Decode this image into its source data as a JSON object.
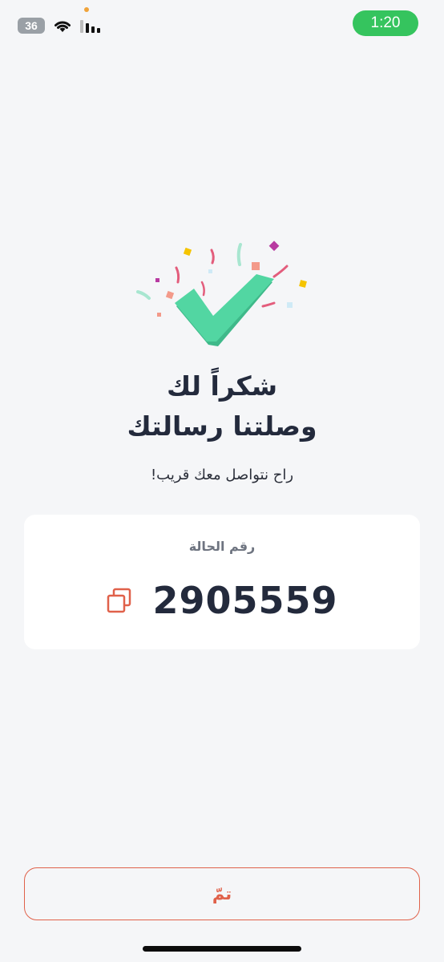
{
  "status_bar": {
    "battery_level": "36",
    "time": "1:20",
    "icons": [
      "battery-icon",
      "wifi-icon",
      "signal-icon"
    ]
  },
  "success": {
    "title_line1": "شكراً لك",
    "title_line2": "وصلتنا رسالتك",
    "subtitle": "راح نتواصل معك قريب!"
  },
  "case_card": {
    "label": "رقم الحالة",
    "number": "2905559",
    "copy_icon": "copy-icon"
  },
  "actions": {
    "done_label": "تمّ"
  },
  "colors": {
    "accent": "#e0614a",
    "check": "#4fd6a3",
    "status_green": "#35c45e",
    "background": "#f5f6f8"
  }
}
